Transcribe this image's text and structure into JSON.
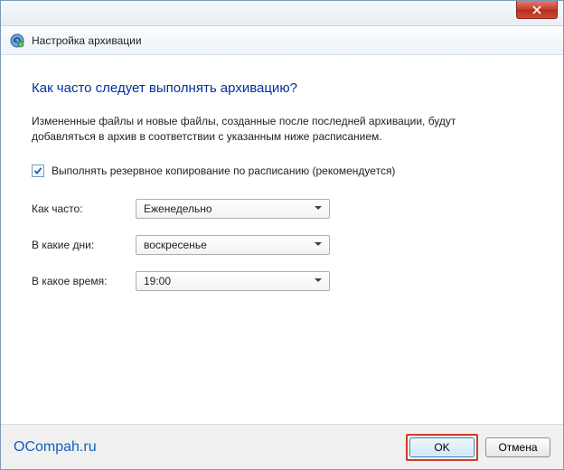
{
  "window": {
    "title": "Настройка архивации"
  },
  "content": {
    "heading": "Как часто следует выполнять архивацию?",
    "description": "Измененные файлы и новые файлы, созданные после последней архивации, будут добавляться в архив в соответствии с указанным ниже расписанием.",
    "schedule_checkbox_label": "Выполнять резервное копирование по расписанию (рекомендуется)",
    "schedule_checked": true,
    "fields": {
      "frequency": {
        "label": "Как часто:",
        "value": "Еженедельно"
      },
      "day": {
        "label": "В какие дни:",
        "value": "воскресенье"
      },
      "time": {
        "label": "В какое время:",
        "value": "19:00"
      }
    }
  },
  "footer": {
    "watermark": "OCompah.ru",
    "ok": "OK",
    "cancel": "Отмена"
  }
}
